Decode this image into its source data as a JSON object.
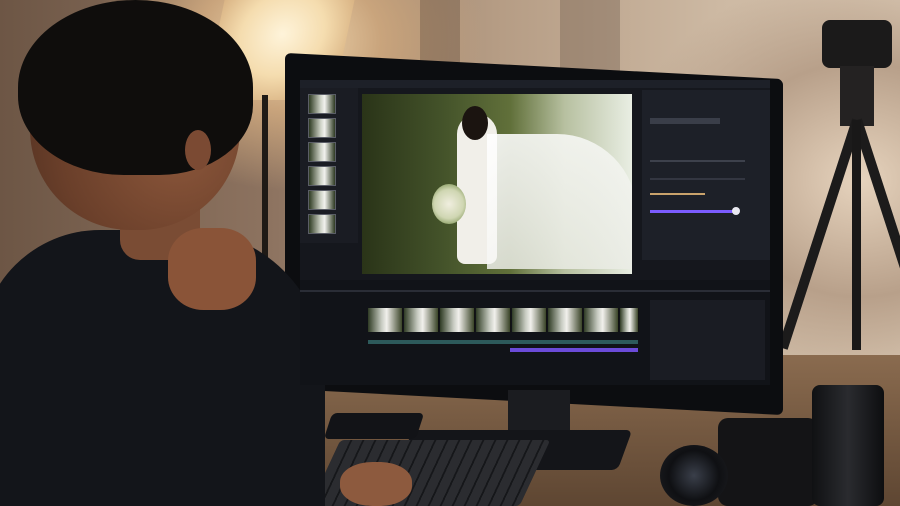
{
  "scene": {
    "description_icons": [
      "monitor-icon",
      "camera-icon",
      "tripod-icon",
      "lamp-icon",
      "keyboard-icon",
      "lens-icon"
    ]
  },
  "editor": {
    "panel_label": "",
    "colors": {
      "accent": "#7b5cff",
      "bg": "#15171d",
      "panel": "#1d2028"
    },
    "slider_level": 0.85
  }
}
